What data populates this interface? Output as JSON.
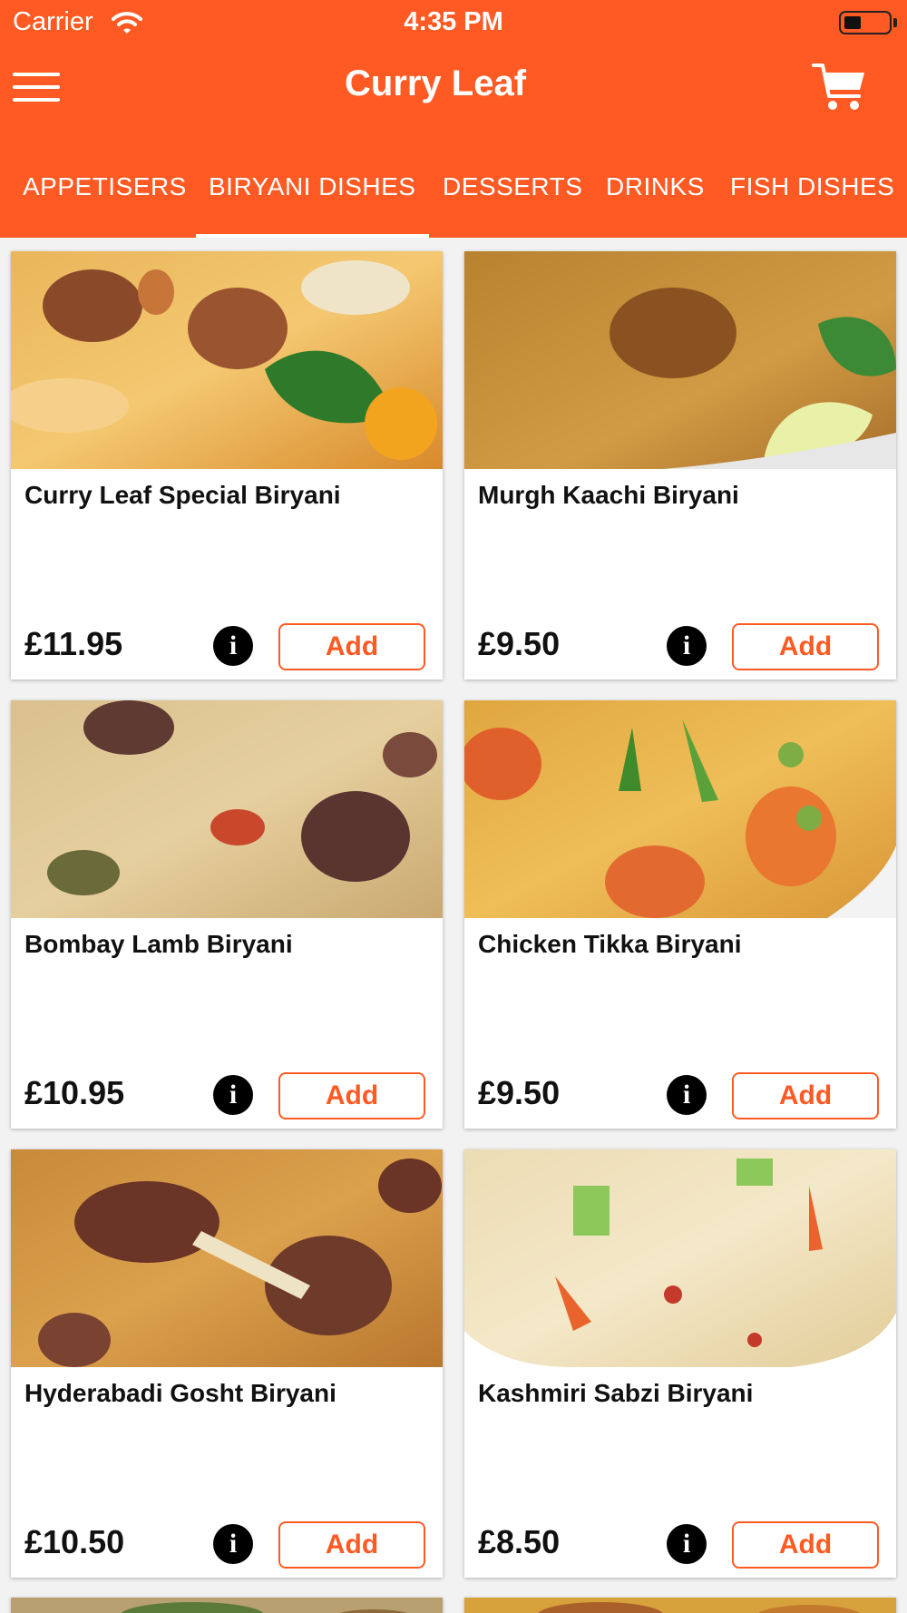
{
  "status_bar": {
    "carrier": "Carrier",
    "time": "4:35 PM"
  },
  "header": {
    "title": "Curry Leaf",
    "menu_icon": "hamburger-menu-icon",
    "cart_icon": "shopping-cart-icon"
  },
  "tabs": [
    {
      "label": "APPETISERS",
      "selected": false
    },
    {
      "label": "BIRYANI DISHES",
      "selected": true
    },
    {
      "label": "DESSERTS",
      "selected": false
    },
    {
      "label": "DRINKS",
      "selected": false
    },
    {
      "label": "FISH DISHES",
      "selected": false
    }
  ],
  "colors": {
    "brand": "#ff5a23",
    "text": "#111111",
    "card_bg": "#ffffff"
  },
  "items": [
    {
      "name": "Curry Leaf Special Biryani",
      "price": "£11.95",
      "add_label": "Add",
      "info_label": "i"
    },
    {
      "name": "Murgh Kaachi Biryani",
      "price": "£9.50",
      "add_label": "Add",
      "info_label": "i"
    },
    {
      "name": "Bombay Lamb Biryani",
      "price": "£10.95",
      "add_label": "Add",
      "info_label": "i"
    },
    {
      "name": "Chicken Tikka Biryani",
      "price": "£9.50",
      "add_label": "Add",
      "info_label": "i"
    },
    {
      "name": "Hyderabadi Gosht Biryani",
      "price": "£10.50",
      "add_label": "Add",
      "info_label": "i"
    },
    {
      "name": "Kashmiri Sabzi Biryani",
      "price": "£8.50",
      "add_label": "Add",
      "info_label": "i"
    }
  ]
}
